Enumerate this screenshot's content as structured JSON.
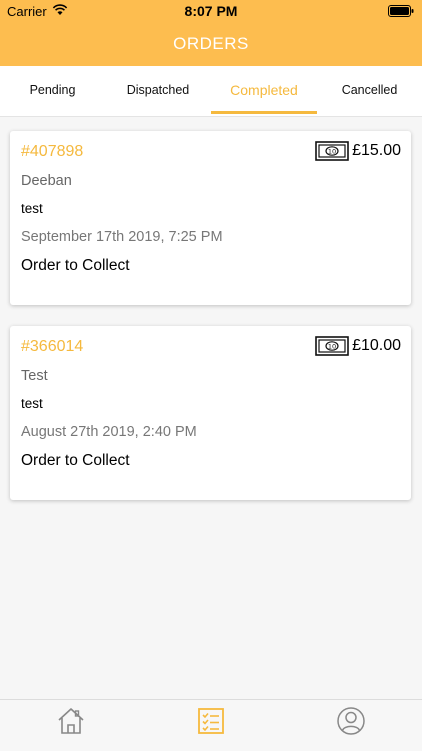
{
  "status_bar": {
    "carrier": "Carrier",
    "time": "8:07 PM"
  },
  "header": {
    "title": "ORDERS"
  },
  "tabs": [
    {
      "label": "Pending",
      "active": false
    },
    {
      "label": "Dispatched",
      "active": false
    },
    {
      "label": "Completed",
      "active": true
    },
    {
      "label": "Cancelled",
      "active": false
    }
  ],
  "orders": [
    {
      "id": "#407898",
      "amount": "£15.00",
      "customer": "Deeban",
      "note": "test",
      "datetime": "September 17th 2019, 7:25 PM",
      "type": "Order to Collect",
      "icon": "cash-note-icon"
    },
    {
      "id": "#366014",
      "amount": "£10.00",
      "customer": "Test",
      "note": "test",
      "datetime": "August 27th 2019, 2:40 PM",
      "type": "Order to Collect",
      "icon": "cash-note-icon"
    }
  ],
  "bottom_nav": [
    {
      "icon": "home-icon",
      "active": false
    },
    {
      "icon": "order-list-icon",
      "active": true
    },
    {
      "icon": "profile-icon",
      "active": false
    }
  ],
  "colors": {
    "accent": "#fdbd4f",
    "active_text": "#f5b93e"
  }
}
